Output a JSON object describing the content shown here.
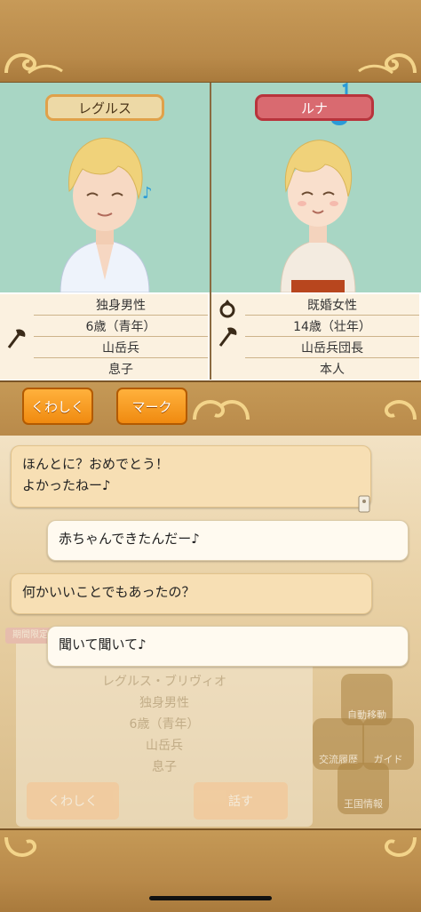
{
  "characters": {
    "left": {
      "name": "レグルス",
      "info": [
        "独身男性",
        "6歳（青年）",
        "山岳兵",
        "息子"
      ],
      "icons": [
        "axe-icon"
      ]
    },
    "right": {
      "name": "ルナ",
      "info": [
        "既婚女性",
        "14歳（壮年）",
        "山岳兵団長",
        "本人"
      ],
      "icons": [
        "ring-icon",
        "axe-icon"
      ]
    }
  },
  "buttons": {
    "details": "くわしく",
    "mark": "マーク"
  },
  "chat": [
    {
      "side": "left",
      "lines": [
        "ほんとに？おめでとう！",
        "よかったねー♪"
      ]
    },
    {
      "side": "right",
      "lines": [
        "赤ちゃんできたんだー♪"
      ]
    },
    {
      "side": "left",
      "lines": [
        "何かいいことでもあったの？"
      ]
    },
    {
      "side": "right",
      "lines": [
        "聞いて聞いて♪"
      ]
    }
  ],
  "background_panel": {
    "tag": "期間限定",
    "lines": [
      "レグルス・ブリヴィオ",
      "独身男性",
      "6歳（青年）",
      "山岳兵",
      "息子"
    ],
    "button_left": "くわしく",
    "button_right": "話す",
    "side_icons": [
      "自動移動",
      "交流履歴",
      "ガイド",
      "王国情報"
    ]
  },
  "colors": {
    "accent_orange": "#f08a10",
    "frame_brown": "#b98a4a",
    "portrait_bg": "#a8d6c4",
    "name_left_bg": "#edd9a6",
    "name_right_bg": "#d96a70"
  }
}
